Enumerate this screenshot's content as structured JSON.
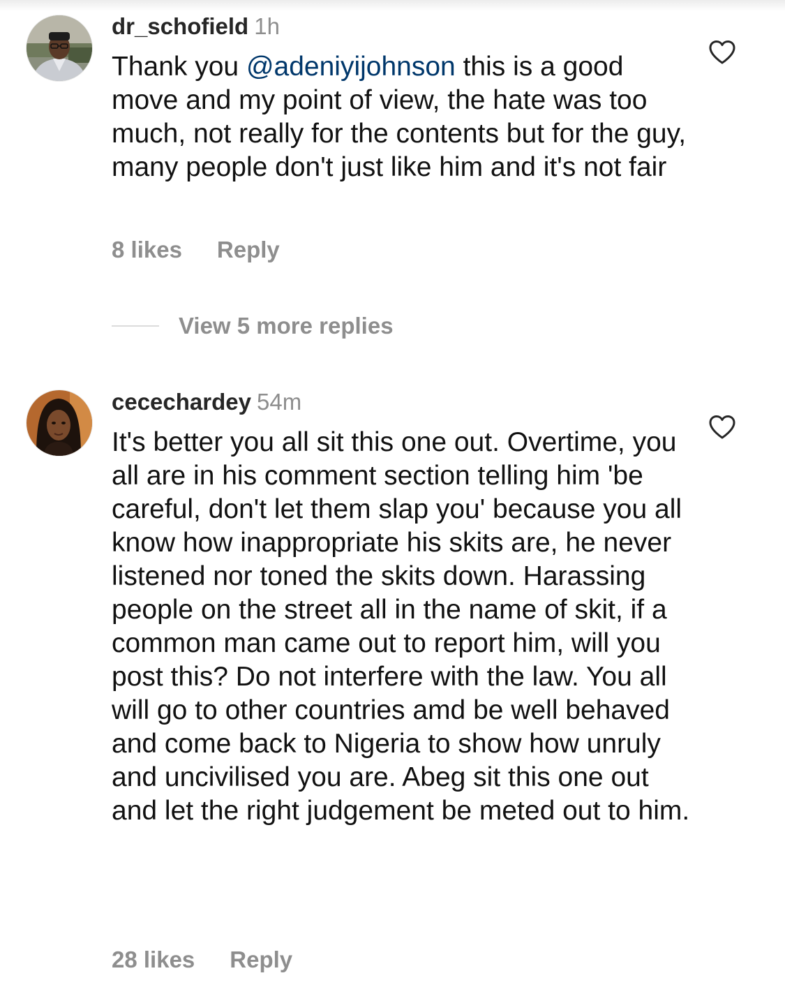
{
  "comments": [
    {
      "username": "dr_schofield",
      "time": "1h",
      "text_before": "Thank you ",
      "mention": "@adeniyijohnson",
      "text_after": " this is a good move and my point of view, the hate was too much, not really for the contents but for the guy, many people don't just like him and it's not fair",
      "likes": "8 likes",
      "reply_label": "Reply",
      "avatar_icon": "profile-photo-man-with-cap",
      "like_icon": "heart-outline-icon"
    },
    {
      "username": "cecechardey",
      "time": "54m",
      "text": "It's better you all sit this one out. Overtime, you all are in his comment section telling him 'be careful, don't let them slap you' because you all know how inappropriate his skits are, he never listened nor toned the skits down. Harassing people on the street all in the name of skit, if a common man came out to report him, will you post this? Do not interfere with the law. You all will go to other countries amd be well behaved and come back to Nigeria to show how unruly and uncivilised you are. Abeg sit this one out and let the right judgement be meted out to him.",
      "likes": "28 likes",
      "reply_label": "Reply",
      "avatar_icon": "profile-photo-woman",
      "like_icon": "heart-outline-icon"
    }
  ],
  "view_replies": {
    "label": "View 5 more replies"
  },
  "colors": {
    "text_primary": "#262626",
    "text_secondary": "#8e8e8e",
    "mention": "#00376b",
    "divider": "#dbdbdb"
  }
}
